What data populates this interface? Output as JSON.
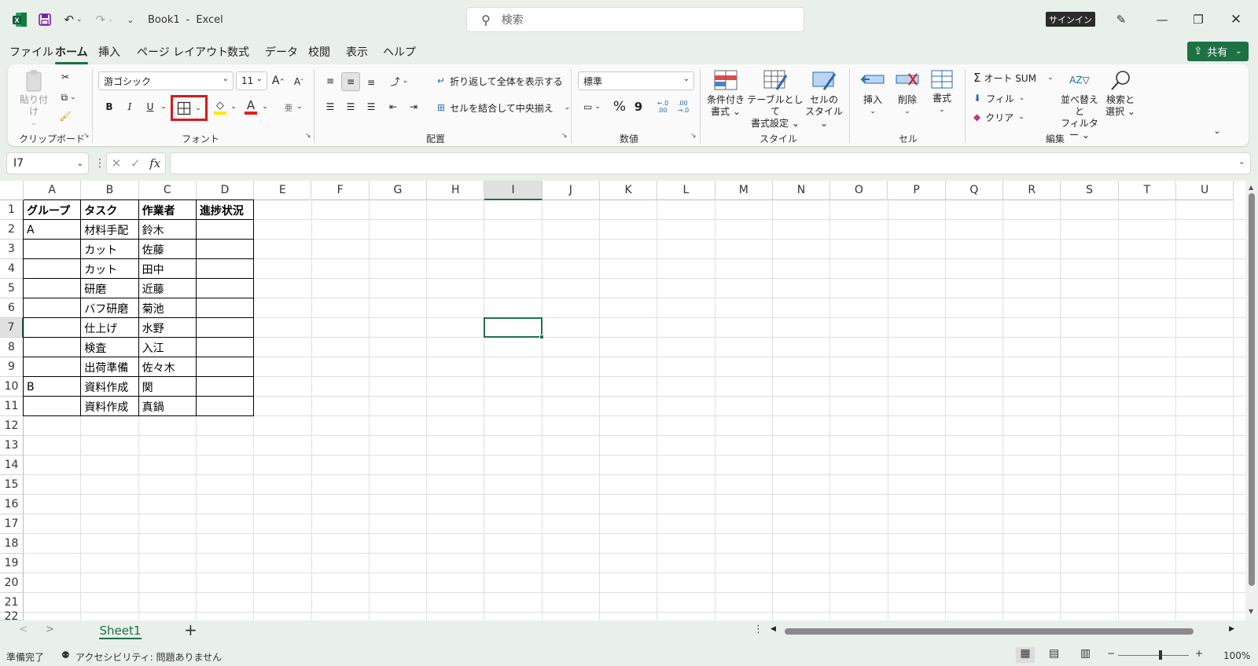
{
  "titlebar": {
    "filename": "Book1",
    "separator": "-",
    "app": "Excel",
    "search_placeholder": "検索",
    "signin": "サインイン"
  },
  "menu": {
    "tabs": [
      "ファイル",
      "ホーム",
      "挿入",
      "ページ レイアウト",
      "数式",
      "データ",
      "校閲",
      "表示",
      "ヘルプ"
    ],
    "active": "ホーム",
    "share": "共有"
  },
  "ribbon": {
    "clipboard": {
      "paste": "貼り付け",
      "label": "クリップボード"
    },
    "font": {
      "name": "游ゴシック",
      "size": "11",
      "bold": "B",
      "italic": "I",
      "underline": "U",
      "label": "フォント",
      "grow": "A",
      "shrink": "A",
      "font_color": "A",
      "phonetic": "亜"
    },
    "alignment": {
      "wrap": "折り返して全体を表示する",
      "merge": "セルを結合して中央揃え",
      "label": "配置"
    },
    "number": {
      "format": "標準",
      "percent": "%",
      "comma": "9",
      "label": "数値",
      "inc_decimal": "←.0\n.00",
      "dec_decimal": ".00\n→.0"
    },
    "styles": {
      "conditional": [
        "条件付き",
        "書式"
      ],
      "table": [
        "テーブルとして",
        "書式設定"
      ],
      "cell": [
        "セルの",
        "スタイル"
      ],
      "label": "スタイル"
    },
    "cells": {
      "insert": "挿入",
      "delete": "削除",
      "format": "書式",
      "label": "セル"
    },
    "editing": {
      "autosum": "オート SUM",
      "fill": "フィル",
      "clear": "クリア",
      "sort": [
        "並べ替えと",
        "フィルター"
      ],
      "find": [
        "検索と",
        "選択"
      ],
      "label": "編集",
      "sigma": "Σ",
      "sort_glyph": "AZ"
    }
  },
  "formula_bar": {
    "name_box": "I7",
    "fx": "fx",
    "value": ""
  },
  "sheet": {
    "columns": [
      "A",
      "B",
      "C",
      "D",
      "E",
      "F",
      "G",
      "H",
      "I",
      "J",
      "K",
      "L",
      "M",
      "N",
      "O",
      "P",
      "Q",
      "R",
      "S",
      "T",
      "U"
    ],
    "selected_column": "I",
    "rows": [
      "1",
      "2",
      "3",
      "4",
      "5",
      "6",
      "7",
      "8",
      "9",
      "10",
      "11",
      "12",
      "13",
      "14",
      "15",
      "16",
      "17",
      "18",
      "19",
      "20",
      "21",
      "22"
    ],
    "selected_row": "7",
    "table": [
      [
        "グループ",
        "タスク",
        "作業者",
        "進捗状況"
      ],
      [
        "A",
        "材料手配",
        "鈴木",
        ""
      ],
      [
        "",
        "カット",
        "佐藤",
        ""
      ],
      [
        "",
        "カット",
        "田中",
        ""
      ],
      [
        "",
        "研磨",
        "近藤",
        ""
      ],
      [
        "",
        "バフ研磨",
        "菊池",
        ""
      ],
      [
        "",
        "仕上げ",
        "水野",
        ""
      ],
      [
        "",
        "検査",
        "入江",
        ""
      ],
      [
        "",
        "出荷準備",
        "佐々木",
        ""
      ],
      [
        "B",
        "資料作成",
        "関",
        ""
      ],
      [
        "",
        "資料作成",
        "真鍋",
        ""
      ]
    ]
  },
  "sheet_tabs": {
    "active": "Sheet1",
    "add": "+",
    "prev": "<",
    "next": ">"
  },
  "status": {
    "ready": "準備完了",
    "accessibility": "アクセシビリティ: 問題ありません",
    "zoom": "100%"
  },
  "colors": {
    "accent": "#1e7145",
    "highlight_box": "#d8191c"
  }
}
